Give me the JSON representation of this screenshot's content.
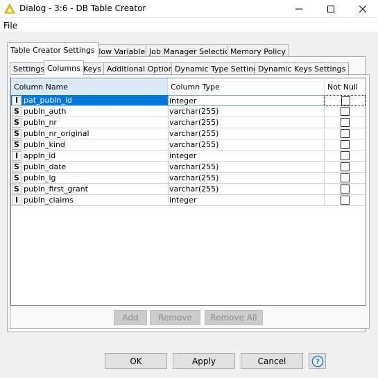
{
  "window": {
    "title": "Dialog - 3:6 - DB Table Creator"
  },
  "menu": {
    "file": "File"
  },
  "outer_tabs": [
    {
      "label": "Table Creator Settings",
      "active": true
    },
    {
      "label": "Flow Variables",
      "active": false
    },
    {
      "label": "Job Manager Selection",
      "active": false
    },
    {
      "label": "Memory Policy",
      "active": false
    }
  ],
  "inner_tabs": [
    {
      "label": "Settings",
      "active": false
    },
    {
      "label": "Columns",
      "active": true
    },
    {
      "label": "Keys",
      "active": false
    },
    {
      "label": "Additional Options",
      "active": false
    },
    {
      "label": "Dynamic Type Settings",
      "active": false
    },
    {
      "label": "Dynamic Keys Settings",
      "active": false
    }
  ],
  "table": {
    "headers": [
      "Column Name",
      "Column Type",
      "Not Null"
    ],
    "rows": [
      {
        "badge": "I",
        "name": "pat_publn_id",
        "type": "integer",
        "not_null": false,
        "selected": true
      },
      {
        "badge": "S",
        "name": "publn_auth",
        "type": "varchar(255)",
        "not_null": false,
        "selected": false
      },
      {
        "badge": "S",
        "name": "publn_nr",
        "type": "varchar(255)",
        "not_null": false,
        "selected": false
      },
      {
        "badge": "S",
        "name": "publn_nr_original",
        "type": "varchar(255)",
        "not_null": false,
        "selected": false
      },
      {
        "badge": "S",
        "name": "publn_kind",
        "type": "varchar(255)",
        "not_null": false,
        "selected": false
      },
      {
        "badge": "I",
        "name": "appln_id",
        "type": "integer",
        "not_null": false,
        "selected": false
      },
      {
        "badge": "S",
        "name": "publn_date",
        "type": "varchar(255)",
        "not_null": false,
        "selected": false
      },
      {
        "badge": "S",
        "name": "publn_lg",
        "type": "varchar(255)",
        "not_null": false,
        "selected": false
      },
      {
        "badge": "S",
        "name": "publn_first_grant",
        "type": "varchar(255)",
        "not_null": false,
        "selected": false
      },
      {
        "badge": "I",
        "name": "publn_claims",
        "type": "integer",
        "not_null": false,
        "selected": false
      }
    ]
  },
  "table_buttons": {
    "add": "Add",
    "remove": "Remove",
    "remove_all": "Remove All"
  },
  "dialog_buttons": {
    "ok": "OK",
    "apply": "Apply",
    "cancel": "Cancel"
  },
  "colors": {
    "selection": "#0078d7",
    "header_highlight": "#d9ebf9",
    "help_accent": "#1e7ad6"
  }
}
